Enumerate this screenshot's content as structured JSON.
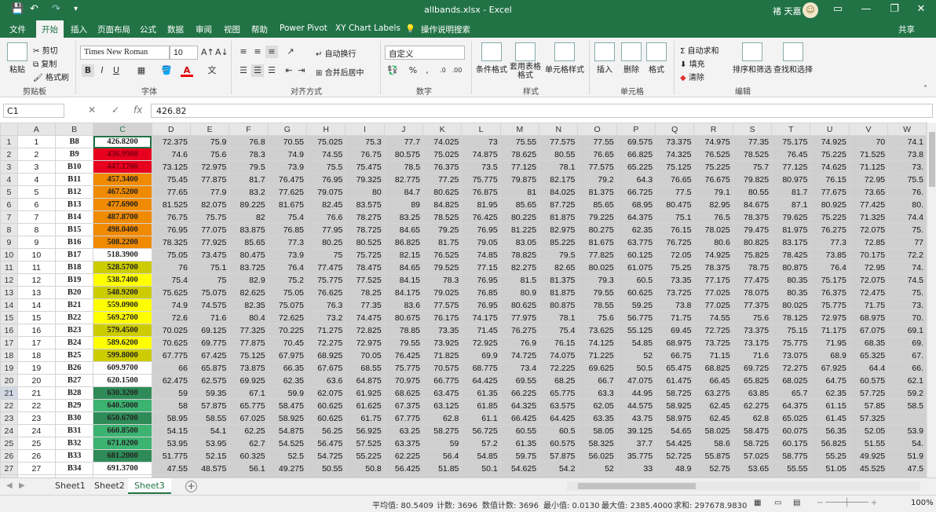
{
  "titlebar": {
    "filename": "allbands.xlsx  -  Excel",
    "user": "褚 天嘉",
    "avatar": "☺",
    "undo": "↶",
    "redo": "↷",
    "save": "💾",
    "customize": "▾",
    "ribbon_opts": "▭",
    "minimize": "—",
    "restore": "❐",
    "close": "✕"
  },
  "tabs": [
    "文件",
    "开始",
    "插入",
    "页面布局",
    "公式",
    "数据",
    "审阅",
    "视图",
    "帮助",
    "Power Pivot",
    "XY Chart Labels",
    "操作说明搜索"
  ],
  "share": "共享",
  "ribbon": {
    "clipboard": {
      "paste": "粘贴",
      "cut": "剪切",
      "copy": "复制",
      "painter": "格式刷",
      "label": "剪贴板"
    },
    "font": {
      "name": "Times New Roman",
      "size": "10",
      "label": "字体",
      "bold": "B",
      "italic": "I",
      "underline": "U",
      "grow": "A↑",
      "shrink": "A↓"
    },
    "align": {
      "wrap": "自动换行",
      "merge": "合并后居中",
      "label": "对齐方式"
    },
    "number": {
      "format": "自定义",
      "percent": "%",
      "comma": ",",
      "label": "数字"
    },
    "styles": {
      "cond": "条件格式",
      "table": "套用表格格式",
      "cell": "单元格样式",
      "label": "样式"
    },
    "cells": {
      "insert": "插入",
      "delete": "删除",
      "format": "格式",
      "label": "单元格"
    },
    "edit": {
      "sum": "自动求和",
      "fill": "填充",
      "clear": "清除",
      "sort": "排序和筛选",
      "find": "查找和选择",
      "label": "编辑"
    }
  },
  "formula_bar": {
    "namebox": "C1",
    "fx": "fx",
    "cancel": "✕",
    "enter": "✓",
    "value": "426.82"
  },
  "columns": [
    "A",
    "B",
    "C",
    "D",
    "E",
    "F",
    "G",
    "H",
    "I",
    "J",
    "K",
    "L",
    "M",
    "N",
    "O",
    "P",
    "Q",
    "R",
    "S",
    "T",
    "U",
    "V",
    "W"
  ],
  "rows": [
    {
      "r": "1",
      "a": "1",
      "b": "B8",
      "c": "426.8200",
      "fill": "#ffffff",
      "v": [
        "72.375",
        "75.9",
        "76.8",
        "70.55",
        "75.025",
        "75.3",
        "77.7",
        "74.025",
        "73",
        "75.55",
        "77.575",
        "77.55",
        "69.575",
        "73.375",
        "74.975",
        "77.35",
        "75.175",
        "74.925",
        "70",
        "74.1"
      ]
    },
    {
      "r": "2",
      "a": "2",
      "b": "B9",
      "c": "436.9900",
      "fill": "#e8001f",
      "v": [
        "74.6",
        "75.6",
        "78.3",
        "74.9",
        "74.55",
        "76.75",
        "80.575",
        "75.025",
        "74.875",
        "78.625",
        "80.55",
        "76.65",
        "66.825",
        "74.325",
        "76.525",
        "78.525",
        "76.45",
        "75.225",
        "71.525",
        "73.8"
      ]
    },
    {
      "r": "3",
      "a": "3",
      "b": "B10",
      "c": "447.1700",
      "fill": "#e8001f",
      "v": [
        "73.125",
        "72.975",
        "79.5",
        "73.9",
        "75.5",
        "75.475",
        "78.5",
        "76.375",
        "73.5",
        "77.125",
        "78.1",
        "77.575",
        "65.225",
        "75.125",
        "75.225",
        "75.7",
        "77.125",
        "74.625",
        "71.125",
        "73."
      ]
    },
    {
      "r": "4",
      "a": "4",
      "b": "B11",
      "c": "457.3400",
      "fill": "#f08a00",
      "v": [
        "75.45",
        "77.875",
        "81.7",
        "76.475",
        "76.95",
        "79.325",
        "82.775",
        "77.25",
        "75.775",
        "79.875",
        "82.175",
        "79.2",
        "64.3",
        "76.65",
        "76.675",
        "79.825",
        "80.975",
        "76.15",
        "72.95",
        "75.5"
      ]
    },
    {
      "r": "5",
      "a": "5",
      "b": "B12",
      "c": "467.5200",
      "fill": "#f08a00",
      "v": [
        "77.65",
        "77.9",
        "83.2",
        "77.625",
        "79.075",
        "80",
        "84.7",
        "80.625",
        "76.875",
        "81",
        "84.025",
        "81.375",
        "66.725",
        "77.5",
        "79.1",
        "80.55",
        "81.7",
        "77.675",
        "73.65",
        "76."
      ]
    },
    {
      "r": "6",
      "a": "6",
      "b": "B13",
      "c": "477.6900",
      "fill": "#f08a00",
      "v": [
        "81.525",
        "82.075",
        "89.225",
        "81.675",
        "82.45",
        "83.575",
        "89",
        "84.825",
        "81.95",
        "85.65",
        "87.725",
        "85.65",
        "68.95",
        "80.475",
        "82.95",
        "84.675",
        "87.1",
        "80.925",
        "77.425",
        "80."
      ]
    },
    {
      "r": "7",
      "a": "7",
      "b": "B14",
      "c": "487.8700",
      "fill": "#f08a00",
      "v": [
        "76.75",
        "75.75",
        "82",
        "75.4",
        "76.6",
        "78.275",
        "83.25",
        "78.525",
        "76.425",
        "80.225",
        "81.875",
        "79.225",
        "64.375",
        "75.1",
        "76.5",
        "78.375",
        "79.625",
        "75.225",
        "71.325",
        "74.4"
      ]
    },
    {
      "r": "8",
      "a": "8",
      "b": "B15",
      "c": "498.0400",
      "fill": "#f08a00",
      "v": [
        "76.95",
        "77.075",
        "83.875",
        "76.85",
        "77.95",
        "78.725",
        "84.65",
        "79.25",
        "76.95",
        "81.225",
        "82.975",
        "80.275",
        "62.35",
        "76.15",
        "78.025",
        "79.475",
        "81.975",
        "76.275",
        "72.075",
        "75."
      ]
    },
    {
      "r": "9",
      "a": "9",
      "b": "B16",
      "c": "508.2200",
      "fill": "#f08a00",
      "v": [
        "78.325",
        "77.925",
        "85.65",
        "77.3",
        "80.25",
        "80.525",
        "86.825",
        "81.75",
        "79.05",
        "83.05",
        "85.225",
        "81.675",
        "63.775",
        "76.725",
        "80.6",
        "80.825",
        "83.175",
        "77.3",
        "72.85",
        "77"
      ]
    },
    {
      "r": "10",
      "a": "10",
      "b": "B17",
      "c": "518.3900",
      "fill": "#ffffff",
      "v": [
        "75.05",
        "73.475",
        "80.475",
        "73.9",
        "75",
        "75.725",
        "82.15",
        "76.525",
        "74.85",
        "78.825",
        "79.5",
        "77.825",
        "60.125",
        "72.05",
        "74.925",
        "75.825",
        "78.425",
        "73.85",
        "70.175",
        "72.2"
      ]
    },
    {
      "r": "11",
      "a": "11",
      "b": "B18",
      "c": "528.5700",
      "fill": "#cccc00",
      "v": [
        "76",
        "75.1",
        "83.725",
        "76.4",
        "77.475",
        "78.475",
        "84.65",
        "79.525",
        "77.15",
        "82.275",
        "82.65",
        "80.025",
        "61.075",
        "75.25",
        "78.375",
        "78.75",
        "80.875",
        "76.4",
        "72.95",
        "74."
      ]
    },
    {
      "r": "12",
      "a": "12",
      "b": "B19",
      "c": "538.7400",
      "fill": "#ffff00",
      "v": [
        "75.4",
        "75",
        "82.9",
        "75.2",
        "75.775",
        "77.525",
        "84.15",
        "78.3",
        "76.95",
        "81.5",
        "81.375",
        "79.3",
        "60.5",
        "73.35",
        "77.175",
        "77.475",
        "80.35",
        "75.175",
        "72.075",
        "74.5"
      ]
    },
    {
      "r": "13",
      "a": "13",
      "b": "B20",
      "c": "548.9200",
      "fill": "#cccc00",
      "v": [
        "75.625",
        "75.075",
        "82.625",
        "75.05",
        "76.625",
        "78.25",
        "84.175",
        "79.025",
        "76.85",
        "80.9",
        "81.875",
        "79.55",
        "60.625",
        "73.725",
        "77.025",
        "78.075",
        "80.35",
        "76.375",
        "72.475",
        "75."
      ]
    },
    {
      "r": "14",
      "a": "14",
      "b": "B21",
      "c": "559.0900",
      "fill": "#ffff00",
      "v": [
        "74.9",
        "74.575",
        "82.35",
        "75.075",
        "76.3",
        "77.35",
        "83.6",
        "77.575",
        "76.95",
        "80.625",
        "80.875",
        "78.55",
        "59.25",
        "73.8",
        "77.025",
        "77.375",
        "80.025",
        "75.775",
        "71.75",
        "73."
      ]
    },
    {
      "r": "15",
      "a": "15",
      "b": "B22",
      "c": "569.2700",
      "fill": "#ffff00",
      "v": [
        "72.6",
        "71.6",
        "80.4",
        "72.625",
        "73.2",
        "74.475",
        "80.675",
        "76.175",
        "74.175",
        "77.975",
        "78.1",
        "75.6",
        "56.775",
        "71.75",
        "74.55",
        "75.6",
        "78.125",
        "72.975",
        "68.975",
        "70."
      ]
    },
    {
      "r": "16",
      "a": "16",
      "b": "B23",
      "c": "579.4500",
      "fill": "#cccc00",
      "v": [
        "70.025",
        "69.125",
        "77.325",
        "70.225",
        "71.275",
        "72.825",
        "78.85",
        "73.35",
        "71.45",
        "76.275",
        "75.4",
        "73.625",
        "55.125",
        "69.45",
        "72.725",
        "73.375",
        "75.15",
        "71.175",
        "67.075",
        "69.1"
      ]
    },
    {
      "r": "17",
      "a": "17",
      "b": "B24",
      "c": "589.6200",
      "fill": "#ffff00",
      "v": [
        "70.625",
        "69.775",
        "77.875",
        "70.45",
        "72.275",
        "72.975",
        "79.55",
        "73.925",
        "72.925",
        "76.9",
        "76.15",
        "74.125",
        "54.85",
        "68.975",
        "73.725",
        "73.175",
        "75.775",
        "71.95",
        "68.35",
        "69."
      ]
    },
    {
      "r": "18",
      "a": "18",
      "b": "B25",
      "c": "599.8000",
      "fill": "#cccc00",
      "v": [
        "67.775",
        "67.425",
        "75.125",
        "67.975",
        "68.925",
        "70.05",
        "76.425",
        "71.825",
        "69.9",
        "74.725",
        "74.075",
        "71.225",
        "52",
        "66.75",
        "71.15",
        "71.6",
        "73.075",
        "68.9",
        "65.325",
        "67."
      ]
    },
    {
      "r": "19",
      "a": "19",
      "b": "B26",
      "c": "609.9700",
      "fill": "#ffffff",
      "v": [
        "66",
        "65.875",
        "73.875",
        "66.35",
        "67.675",
        "68.55",
        "75.775",
        "70.575",
        "68.775",
        "73.4",
        "72.225",
        "69.625",
        "50.5",
        "65.475",
        "68.825",
        "69.725",
        "72.275",
        "67.925",
        "64.4",
        "66."
      ]
    },
    {
      "r": "20",
      "a": "20",
      "b": "B27",
      "c": "620.1500",
      "fill": "#ffffff",
      "v": [
        "62.475",
        "62.575",
        "69.925",
        "62.35",
        "63.6",
        "64.875",
        "70.975",
        "66.775",
        "64.425",
        "69.55",
        "68.25",
        "66.7",
        "47.075",
        "61.475",
        "66.45",
        "65.825",
        "68.025",
        "64.75",
        "60.575",
        "62.1"
      ]
    },
    {
      "r": "21",
      "a": "21",
      "b": "B28",
      "c": "630.3200",
      "fill": "#2e8b57",
      "v": [
        "59",
        "59.35",
        "67.1",
        "59.9",
        "62.075",
        "61.925",
        "68.625",
        "63.475",
        "61.35",
        "66.225",
        "65.775",
        "63.3",
        "44.95",
        "58.725",
        "63.275",
        "63.85",
        "65.7",
        "62.35",
        "57.725",
        "59.2"
      ]
    },
    {
      "r": "22",
      "a": "22",
      "b": "B29",
      "c": "640.5000",
      "fill": "#3cb371",
      "v": [
        "58",
        "57.875",
        "65.775",
        "58.475",
        "60.625",
        "61.625",
        "67.375",
        "63.125",
        "61.85",
        "64.325",
        "63.575",
        "62.05",
        "44.575",
        "58.925",
        "62.45",
        "62.275",
        "64.375",
        "61.15",
        "57.85",
        "58.5"
      ]
    },
    {
      "r": "23",
      "a": "23",
      "b": "B30",
      "c": "650.6700",
      "fill": "#2e8b57",
      "v": [
        "58.95",
        "58.55",
        "67.025",
        "58.925",
        "60.625",
        "61.75",
        "67.775",
        "62.8",
        "61.1",
        "66.425",
        "64.425",
        "63.35",
        "43.75",
        "58.975",
        "62.45",
        "62.8",
        "65.025",
        "61.45",
        "57.325",
        ""
      ]
    },
    {
      "r": "24",
      "a": "24",
      "b": "B31",
      "c": "660.8500",
      "fill": "#3cb371",
      "v": [
        "54.15",
        "54.1",
        "62.25",
        "54.875",
        "56.25",
        "56.925",
        "63.25",
        "58.275",
        "56.725",
        "60.55",
        "60.5",
        "58.05",
        "39.125",
        "54.65",
        "58.025",
        "58.475",
        "60.075",
        "56.35",
        "52.05",
        "53.9"
      ]
    },
    {
      "r": "25",
      "a": "25",
      "b": "B32",
      "c": "671.0200",
      "fill": "#3cb371",
      "v": [
        "53.95",
        "53.95",
        "62.7",
        "54.525",
        "56.475",
        "57.525",
        "63.375",
        "59",
        "57.2",
        "61.35",
        "60.575",
        "58.325",
        "37.7",
        "54.425",
        "58.6",
        "58.725",
        "60.175",
        "56.825",
        "51.55",
        "54."
      ]
    },
    {
      "r": "26",
      "a": "26",
      "b": "B33",
      "c": "681.2000",
      "fill": "#2e8b57",
      "v": [
        "51.775",
        "52.15",
        "60.325",
        "52.5",
        "54.725",
        "55.225",
        "62.225",
        "56.4",
        "54.85",
        "59.75",
        "57.875",
        "56.025",
        "35.775",
        "52.725",
        "55.875",
        "57.025",
        "58.775",
        "55.25",
        "49.925",
        "51.9"
      ]
    },
    {
      "r": "27",
      "a": "27",
      "b": "B34",
      "c": "691.3700",
      "fill": "#ffffff",
      "v": [
        "47.55",
        "48.575",
        "56.1",
        "49.275",
        "50.55",
        "50.8",
        "56.425",
        "51.85",
        "50.1",
        "54.625",
        "54.2",
        "52",
        "33",
        "48.9",
        "52.75",
        "53.65",
        "55.55",
        "51.05",
        "45.525",
        "47.5"
      ]
    },
    {
      "r": "28",
      "a": "28",
      "b": "B35",
      "c": "701.5500",
      "fill": "#ffffff",
      "v": [
        "48.9",
        "48.55",
        "55.5",
        "48.475",
        "50.5",
        "51.375",
        "57.6",
        "53.425",
        "52.225",
        "55.625",
        "53.65",
        "52.925",
        "35.6",
        "49.45",
        "54.05",
        "51.9",
        "53.75",
        "52.275",
        "49.325",
        "50.5"
      ]
    }
  ],
  "sheets": [
    "Sheet1",
    "Sheet2",
    "Sheet3"
  ],
  "active_sheet": "Sheet3",
  "status": {
    "avg": "平均值: 80.5409",
    "count": "计数: 3696",
    "numcount": "数值计数: 3696",
    "min": "最小值: 0.0130",
    "max": "最大值: 2385.4000",
    "sum": "求和: 297678.9830",
    "zoom": "100%"
  },
  "colors": {
    "excel_green": "#217346",
    "header_gray": "#e6e6e6",
    "data_gray": "#cfcfcf"
  }
}
